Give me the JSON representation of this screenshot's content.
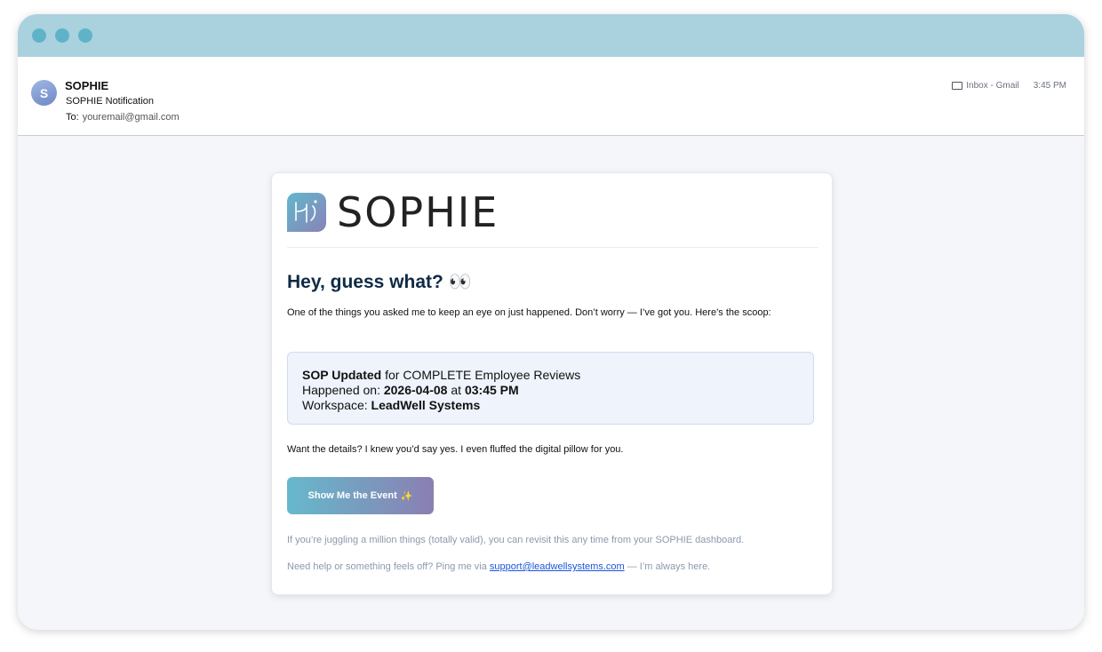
{
  "mail": {
    "avatar_letter": "S",
    "sender": "SOPHIE",
    "subject": "SOPHIE Notification",
    "to_label": "To:",
    "to_address": "youremail@gmail.com",
    "folder": "Inbox - Gmail",
    "time": "3:45 PM"
  },
  "email": {
    "logo_text": "SOPHIE",
    "headline": "Hey, guess what? 👀",
    "intro": "One of the things you asked me to keep an eye on just happened. Don’t worry — I’ve got you. Here’s the scoop:",
    "event_type": "SOP Updated",
    "event_for": " for COMPLETE Employee Reviews",
    "happened_label": "Happened on: ",
    "date": "2026-04-08",
    "at_label": " at ",
    "time": "03:45 PM",
    "workspace_label": "Workspace: ",
    "workspace": "LeadWell Systems",
    "want_text": "Want the details? I knew you’d say yes. I even fluffed the digital pillow for you.",
    "cta_label": "Show Me the Event",
    "cta_icon": "✨",
    "footer_revisit": "If you’re juggling a million things (totally valid), you can revisit this any time from your SOPHIE dashboard.",
    "footer_help_prefix": "Need help or something feels off? Ping me via ",
    "support_email": "support@leadwellsystems.com",
    "footer_help_suffix": " — I’m always here."
  },
  "colors": {
    "titlebar": "#a9d1de",
    "traffic_dots": "#5fb3c9",
    "brand_gradient_start": "#66b9cc",
    "brand_gradient_end": "#8a7fb2",
    "headline": "#0f2a45",
    "link": "#1a56db"
  }
}
